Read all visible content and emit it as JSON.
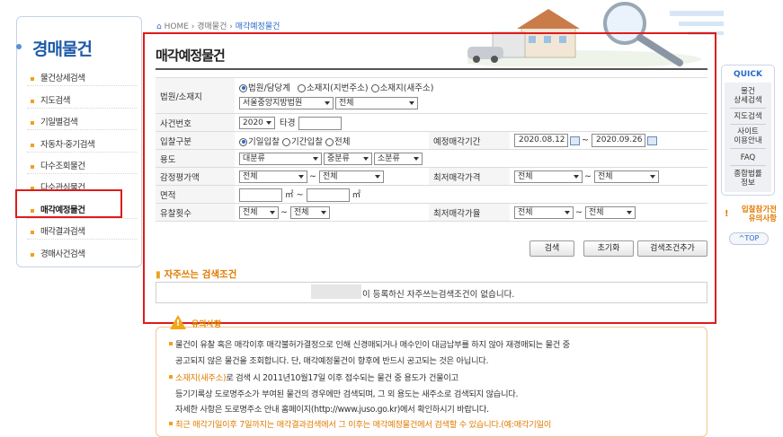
{
  "breadcrumb": {
    "home": "HOME",
    "level1": "경매물건",
    "current": "매각예정물건"
  },
  "sidebar": {
    "title": "경매물건",
    "items": [
      {
        "label": "물건상세검색"
      },
      {
        "label": "지도검색"
      },
      {
        "label": "기일별검색"
      },
      {
        "label": "자동차·중기검색"
      },
      {
        "label": "다수조회물건"
      },
      {
        "label": "다수관심물건"
      },
      {
        "label": "매각예정물건"
      },
      {
        "label": "매각결과검색"
      },
      {
        "label": "경매사건검색"
      }
    ]
  },
  "page": {
    "title": "매각예정물건"
  },
  "form": {
    "court_label": "법원/소재지",
    "court_radio1": "법원/담당계",
    "court_radio2": "소재지(지번주소)",
    "court_radio3": "소재지(새주소)",
    "court_select": "서울중앙지방법원",
    "court_dept": "전체",
    "case_label": "사건번호",
    "case_year": "2020",
    "case_type": "타경",
    "case_number": "",
    "bid_label": "입찰구분",
    "bid_radio1": "기일입찰",
    "bid_radio2": "기간입찰",
    "bid_radio3": "전체",
    "date_label": "예정매각기간",
    "date_from": "2020.08.12",
    "date_to": "2020.09.26",
    "tilde": "~",
    "use_label": "용도",
    "use_big": "대분류",
    "use_mid": "중분류",
    "use_small": "소분류",
    "appraisal_label": "감정평가액",
    "appraisal_from": "전체",
    "appraisal_to": "전체",
    "minprice_label": "최저매각가격",
    "minprice_from": "전체",
    "minprice_to": "전체",
    "area_label": "면적",
    "area_unit": "㎡",
    "fail_label": "유찰횟수",
    "fail_from": "전체",
    "fail_to": "전체",
    "minrate_label": "최저매각가율",
    "minrate_from": "전체",
    "minrate_to": "전체"
  },
  "buttons": {
    "search": "검색",
    "reset": "초기화",
    "add": "검색조건추가"
  },
  "favorites": {
    "title": "자주쓰는 검색조건",
    "message": "이 등록하신 자주쓰는검색조건이 없습니다."
  },
  "notice": {
    "title": "유의사항",
    "lines": [
      "물건이 유찰 혹은 매각이후 매각불허가결정으로 인해 신경매되거나 매수인이 대금납부를 하지 않아 재경매되는 물건 중",
      "공고되지 않은 물건을 조회합니다. 단, 매각예정물건이 향후에 반드시 공고되는 것은 아닙니다.",
      "로 검색 시 2011년10월17일 이후 접수되는 물건 중 용도가 건물이고",
      "등기기록상 도로명주소가 부여된 물건의 경우에만 검색되며, 그 외 용도는 새주소로 검색되지 않습니다.",
      "자세한 사항은 도로명주소 안내 홈페이지(http://www.juso.go.kr)에서 확인하시기 바랍니다.",
      "최근 매각기일이후 7일까지는 매각결과검색에서 그 이후는 매각예정물건에서 검색할 수 있습니다.(예:매각기일이"
    ],
    "highlight": "소재지(새주소)"
  },
  "quick": {
    "title": "QUICK",
    "items": [
      "물건\n상세검색",
      "지도검색",
      "사이트\n이용안내",
      "FAQ",
      "종합법률\n정보"
    ],
    "bid_notice": "입찰참가전\n유의사항",
    "top": "^TOP"
  },
  "colors": {
    "accent": "#2a6ac8",
    "highlight_border": "#e01b1b",
    "notice": "#e07b00"
  }
}
